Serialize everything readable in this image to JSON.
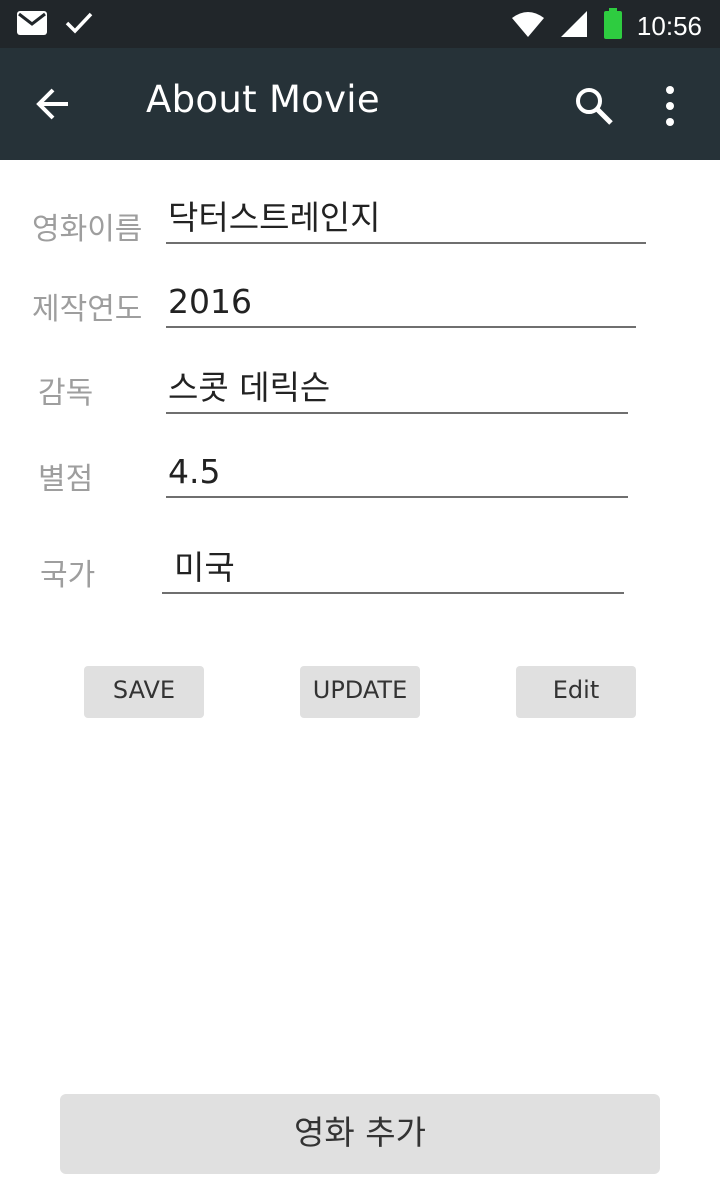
{
  "status_bar": {
    "time": "10:56",
    "icons": [
      "mail-icon",
      "check-icon",
      "wifi-icon",
      "signal-icon",
      "battery-icon"
    ],
    "battery_color": "#2ecc40"
  },
  "app_bar": {
    "title": "About Movie",
    "background": "#263238",
    "icons": [
      "back-arrow-icon",
      "search-icon",
      "more-vert-icon"
    ]
  },
  "form": {
    "movie_name": {
      "label": "영화이름",
      "value": "닥터스트레인지"
    },
    "year": {
      "label": "제작연도",
      "value": "2016"
    },
    "director": {
      "label": "감독",
      "value": "스콧 데릭슨"
    },
    "rating": {
      "label": "별점",
      "value": "4.5"
    },
    "country": {
      "label": "국가",
      "value": "미국"
    }
  },
  "buttons": {
    "save": "SAVE",
    "update": "UPDATE",
    "edit": "Edit",
    "add_movie": "영화 추가"
  }
}
